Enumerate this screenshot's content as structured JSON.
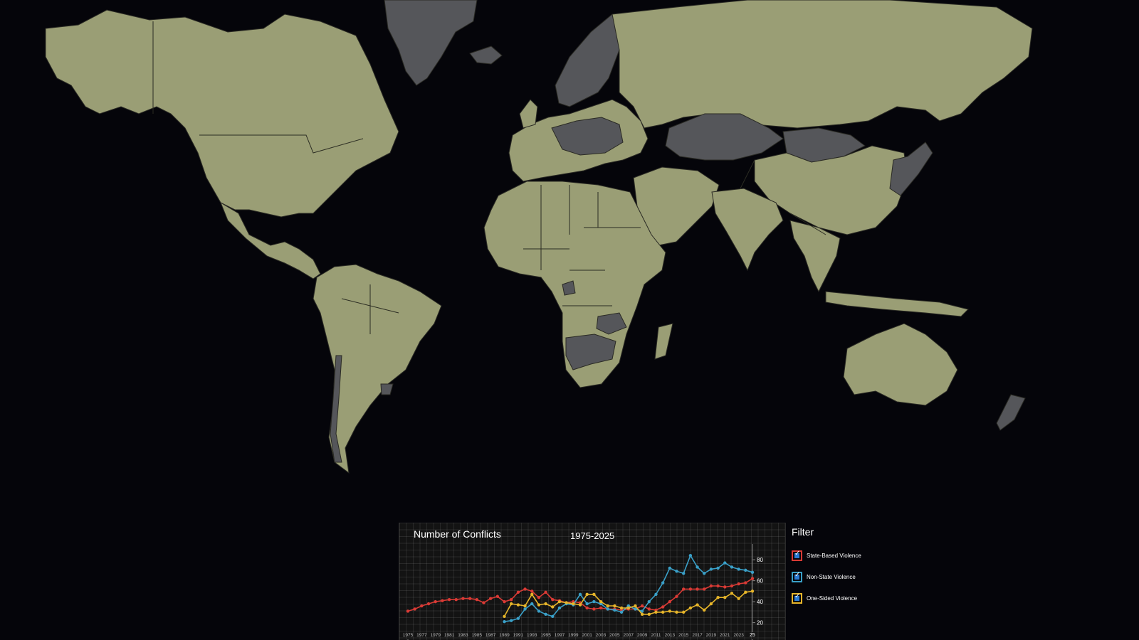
{
  "map": {
    "colors": {
      "ocean": "#05050a",
      "land": "#9a9e75",
      "highlight": "#55565a"
    }
  },
  "chart": {
    "title": "Number of Conflicts",
    "range_label": "1975-2025",
    "right_edge_label": "25"
  },
  "filter": {
    "title": "Filter",
    "items": [
      {
        "label": "State-Based Violence",
        "color": "#d93a35",
        "checked": true
      },
      {
        "label": "Non-State Violence",
        "color": "#3aa0c8",
        "checked": true
      },
      {
        "label": "One-Sided Violence",
        "color": "#e6b52a",
        "checked": true
      }
    ]
  },
  "chart_data": {
    "type": "line",
    "title": "Number of Conflicts",
    "subtitle": "1975-2025",
    "x_tick_labels": [
      "1975",
      "1977",
      "1979",
      "1981",
      "1983",
      "1985",
      "1987",
      "1989",
      "1991",
      "1993",
      "1995",
      "1997",
      "1999",
      "2001",
      "2003",
      "2005",
      "2007",
      "2009",
      "2011",
      "2013",
      "2015",
      "2017",
      "2019",
      "2021",
      "2023"
    ],
    "y_ticks": [
      20,
      40,
      60,
      80
    ],
    "xlim": [
      1975,
      2025
    ],
    "ylim": [
      15,
      95
    ],
    "series": [
      {
        "name": "State-Based Violence",
        "color": "#d93a35",
        "x": [
          1975,
          1976,
          1977,
          1978,
          1979,
          1980,
          1981,
          1982,
          1983,
          1984,
          1985,
          1986,
          1987,
          1988,
          1989,
          1990,
          1991,
          1992,
          1993,
          1994,
          1995,
          1996,
          1997,
          1998,
          1999,
          2000,
          2001,
          2002,
          2003,
          2004,
          2005,
          2006,
          2007,
          2008,
          2009,
          2010,
          2011,
          2012,
          2013,
          2014,
          2015,
          2016,
          2017,
          2018,
          2019,
          2020,
          2021,
          2022,
          2023,
          2024,
          2025
        ],
        "values": [
          31,
          33,
          36,
          38,
          40,
          41,
          42,
          42,
          43,
          43,
          42,
          39,
          43,
          45,
          40,
          42,
          49,
          52,
          50,
          44,
          49,
          42,
          41,
          39,
          40,
          39,
          34,
          33,
          34,
          33,
          33,
          32,
          33,
          33,
          36,
          33,
          32,
          35,
          40,
          45,
          52,
          52,
          52,
          52,
          55,
          55,
          54,
          55,
          57,
          58,
          62
        ]
      },
      {
        "name": "Non-State Violence",
        "color": "#3aa0c8",
        "x": [
          1989,
          1990,
          1991,
          1992,
          1993,
          1994,
          1995,
          1996,
          1997,
          1998,
          1999,
          2000,
          2001,
          2002,
          2003,
          2004,
          2005,
          2006,
          2007,
          2008,
          2009,
          2010,
          2011,
          2012,
          2013,
          2014,
          2015,
          2016,
          2017,
          2018,
          2019,
          2020,
          2021,
          2022,
          2023,
          2024,
          2025
        ],
        "values": [
          21,
          22,
          24,
          33,
          38,
          31,
          28,
          26,
          34,
          38,
          37,
          47,
          38,
          40,
          38,
          33,
          32,
          30,
          36,
          33,
          31,
          40,
          47,
          58,
          72,
          69,
          67,
          84,
          73,
          67,
          71,
          72,
          77,
          73,
          71,
          70,
          68
        ]
      },
      {
        "name": "One-Sided Violence",
        "color": "#e6b52a",
        "x": [
          1989,
          1990,
          1991,
          1992,
          1993,
          1994,
          1995,
          1996,
          1997,
          1998,
          1999,
          2000,
          2001,
          2002,
          2003,
          2004,
          2005,
          2006,
          2007,
          2008,
          2009,
          2010,
          2011,
          2012,
          2013,
          2014,
          2015,
          2016,
          2017,
          2018,
          2019,
          2020,
          2021,
          2022,
          2023,
          2024,
          2025
        ],
        "values": [
          26,
          38,
          37,
          36,
          47,
          37,
          38,
          35,
          40,
          39,
          38,
          37,
          47,
          47,
          40,
          36,
          36,
          34,
          34,
          36,
          28,
          28,
          30,
          30,
          31,
          30,
          30,
          34,
          37,
          32,
          38,
          44,
          44,
          48,
          43,
          49,
          50
        ]
      }
    ]
  }
}
